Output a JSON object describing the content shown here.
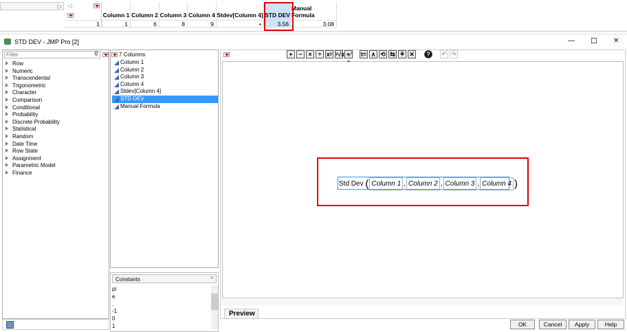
{
  "table": {
    "columns": [
      "Column 1",
      "Column 2",
      "Column 3",
      "Column 4",
      "Stdev[Column 4]",
      "STD DEV",
      "Manual Formula"
    ],
    "row_number": "1",
    "values": [
      "1",
      "6",
      "8",
      "9",
      "•",
      "3.56",
      "3.08"
    ]
  },
  "window": {
    "title": "STD DEV - JMP Pro [2]",
    "minimize": "—",
    "maximize": "☐",
    "close": "✕"
  },
  "functions": {
    "filter_placeholder": "Filter",
    "items": [
      "Row",
      "Numeric",
      "Transcendental",
      "Trigonometric",
      "Character",
      "Comparison",
      "Conditional",
      "Probability",
      "Discrete Probability",
      "Statistical",
      "Random",
      "Date Time",
      "Row State",
      "Assignment",
      "Parametric Model",
      "Finance"
    ]
  },
  "columns_panel": {
    "header": "7 Columns",
    "items": [
      "Column 1",
      "Column 2",
      "Column 3",
      "Column 4",
      "Stdev[Column 4]",
      "STD DEV",
      "Manual Formula"
    ],
    "selected": "STD DEV"
  },
  "constants": {
    "label": "Constants",
    "items": [
      "pi",
      "e",
      ".",
      "-1",
      "0",
      "1"
    ]
  },
  "toolbar": [
    "+",
    "−",
    "×",
    "÷",
    "xʸ",
    "ʸ√x",
    "+⁄−",
    "t=",
    "∧",
    "⟲",
    "⇆",
    "⚘",
    "✕",
    "?",
    "↶",
    "↷"
  ],
  "formula": {
    "function": "Std Dev",
    "args": [
      "Column 1",
      "Column 2",
      "Column 3",
      "Column 4"
    ]
  },
  "preview": "Preview",
  "buttons": {
    "ok": "OK",
    "cancel": "Cancel",
    "apply": "Apply",
    "help": "Help"
  },
  "colors": {
    "highlight": "#cfe3f7",
    "red": "#e00000",
    "selection": "#3399ff"
  }
}
